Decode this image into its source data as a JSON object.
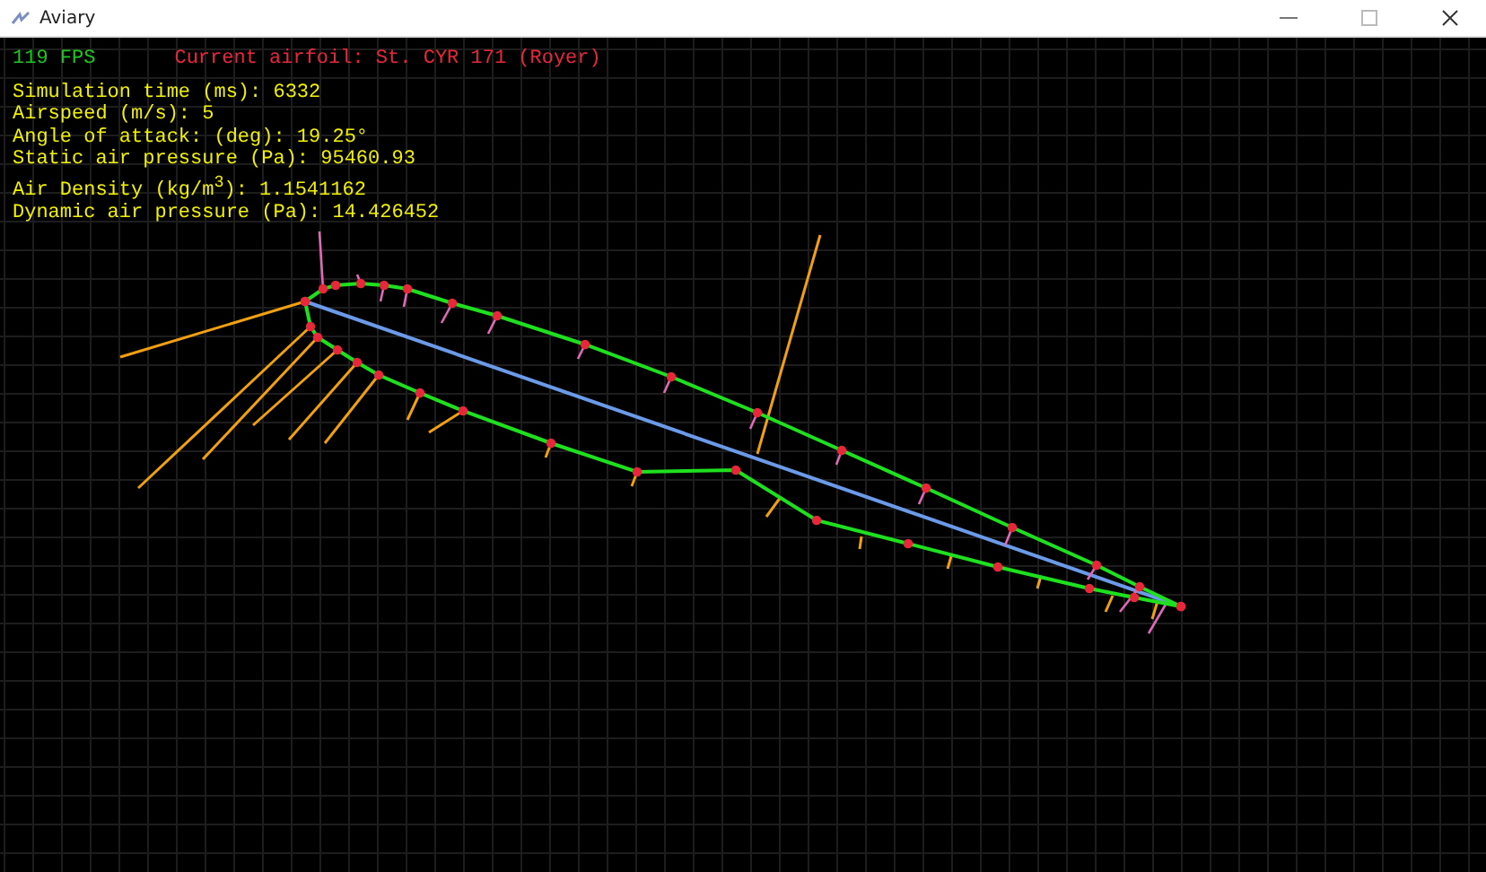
{
  "window": {
    "title": "Aviary"
  },
  "fps": "119 FPS",
  "current_airfoil": "Current airfoil: St. CYR 171 (Royer)",
  "readouts": [
    "Simulation time (ms): 6332",
    "Airspeed (m/s): 5",
    "Angle of attack: (deg): 19.25°",
    "Static air pressure (Pa): 95460.93",
    "Air Density (kg/m$^{3}$): 1.1541162",
    "Dynamic air pressure (Pa): 14.426452"
  ]
}
